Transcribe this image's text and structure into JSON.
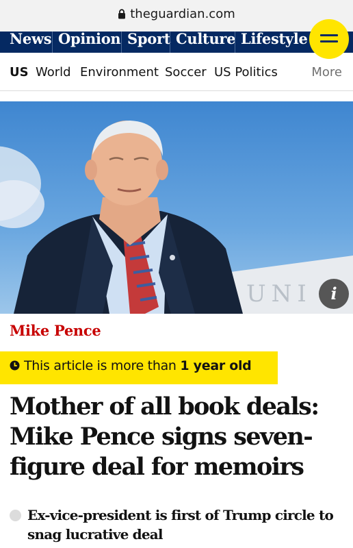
{
  "browser": {
    "url": "theguardian.com"
  },
  "pillars": [
    "News",
    "Opinion",
    "Sport",
    "Culture",
    "Lifestyle"
  ],
  "subnav": {
    "items": [
      "US",
      "World",
      "Environment",
      "Soccer",
      "US Politics"
    ],
    "more": "More"
  },
  "hero": {
    "info_label": "i"
  },
  "article": {
    "kicker": "Mike Pence",
    "age_prefix": "This article is more than ",
    "age_value": "1 year old",
    "headline": "Mother of all book deals: Mike Pence signs seven-figure deal for memoirs",
    "standfirst": "Ex-vice-president is first of Trump circle to snag lucrative deal"
  },
  "colors": {
    "nav": "#052962",
    "accent_yellow": "#ffe500",
    "kicker_red": "#c70000"
  }
}
